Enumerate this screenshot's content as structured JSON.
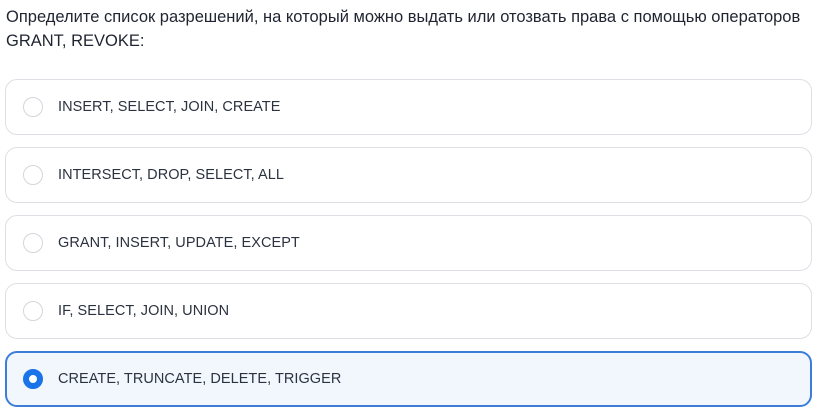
{
  "question": {
    "text": "Определите список разрешений, на который можно выдать или отозвать права с помощью операторов GRANT, REVOKE:"
  },
  "options": [
    {
      "label": "INSERT, SELECT, JOIN, CREATE",
      "selected": false
    },
    {
      "label": "INTERSECT, DROP, SELECT, ALL",
      "selected": false
    },
    {
      "label": "GRANT, INSERT, UPDATE, EXCEPT",
      "selected": false
    },
    {
      "label": "IF, SELECT, JOIN, UNION",
      "selected": false
    },
    {
      "label": "CREATE, TRUNCATE, DELETE, TRIGGER",
      "selected": true
    }
  ],
  "colors": {
    "accent": "#1a73e8",
    "selected_border": "#3b7dd8",
    "selected_background": "#f2f7fd",
    "option_border": "#dcdfe4"
  }
}
